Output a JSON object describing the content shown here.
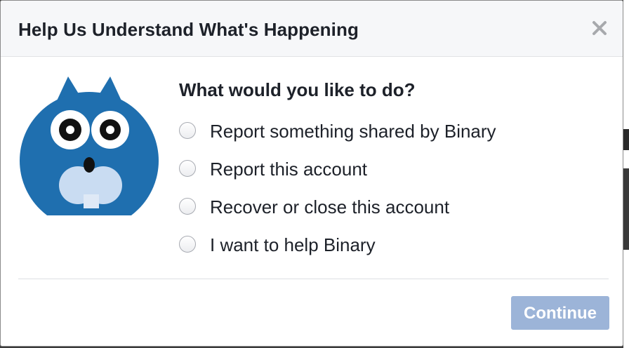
{
  "dialog": {
    "title": "Help Us Understand What's Happening",
    "close_icon": "close-icon"
  },
  "avatar": {
    "icon": "owl-avatar-icon",
    "color": "#1f6faf"
  },
  "question": "What would you like to do?",
  "options": [
    {
      "label": "Report something shared by Binary",
      "selected": false
    },
    {
      "label": "Report this account",
      "selected": false
    },
    {
      "label": "Recover or close this account",
      "selected": false
    },
    {
      "label": "I want to help Binary",
      "selected": false
    }
  ],
  "footer": {
    "continue_label": "Continue",
    "continue_enabled": false,
    "continue_color": "#9cb4d8"
  }
}
